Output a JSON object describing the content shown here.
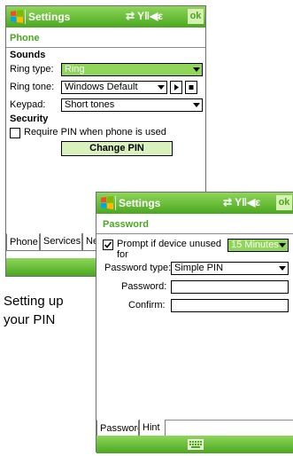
{
  "phone_screen": {
    "title": "Settings",
    "status_icons": "⇄ Y‖◀ε",
    "ok_label": "ok",
    "section_title": "Phone",
    "sounds_heading": "Sounds",
    "ring_type_label": "Ring type:",
    "ring_type_value": "Ring",
    "ring_tone_label": "Ring tone:",
    "ring_tone_value": "Windows Default",
    "keypad_label": "Keypad:",
    "keypad_value": "Short tones",
    "security_heading": "Security",
    "require_pin_label": "Require PIN when phone is used",
    "change_pin_label": "Change PIN",
    "tabs": [
      "Phone",
      "Services",
      "Ne"
    ]
  },
  "caption": {
    "line1": "Setting up",
    "line2": "your PIN"
  },
  "password_screen": {
    "title": "Settings",
    "status_icons": "⇄ Y‖◀ε",
    "ok_label": "ok",
    "section_title": "Password",
    "prompt_label_line1": "Prompt if device unused",
    "prompt_label_line2": "for",
    "prompt_value": "15 Minutes",
    "password_type_label": "Password type:",
    "password_type_value": "Simple PIN",
    "password_label": "Password:",
    "confirm_label": "Confirm:",
    "tabs": [
      "Password",
      "Hint"
    ]
  },
  "colors": {
    "accent_green": "#4aa71f",
    "titlebar_green": "#8fd65a"
  },
  "icons": [
    "windows-flag-icon",
    "connectivity-icon",
    "signal-icon",
    "volume-icon",
    "play-icon",
    "stop-icon",
    "checkmark-icon",
    "keyboard-icon"
  ]
}
